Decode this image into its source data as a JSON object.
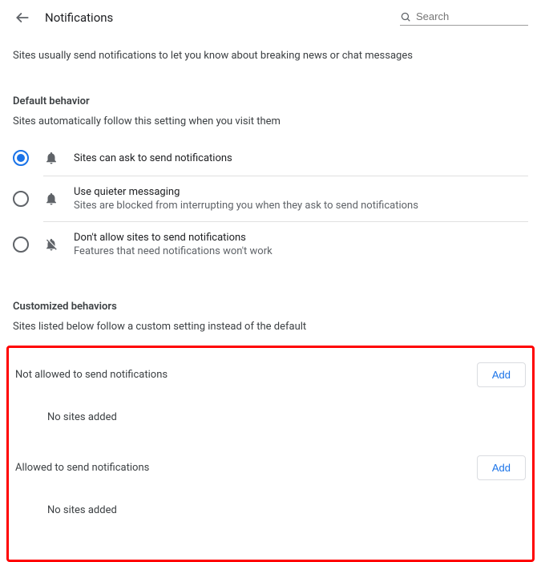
{
  "header": {
    "title": "Notifications",
    "search_placeholder": "Search"
  },
  "intro": "Sites usually send notifications to let you know about breaking news or chat messages",
  "default_behavior": {
    "heading": "Default behavior",
    "sub": "Sites automatically follow this setting when you visit them",
    "options": [
      {
        "title": "Sites can ask to send notifications",
        "desc": "",
        "selected": true
      },
      {
        "title": "Use quieter messaging",
        "desc": "Sites are blocked from interrupting you when they ask to send notifications",
        "selected": false
      },
      {
        "title": "Don't allow sites to send notifications",
        "desc": "Features that need notifications won't work",
        "selected": false
      }
    ]
  },
  "customized": {
    "heading": "Customized behaviors",
    "sub": "Sites listed below follow a custom setting instead of the default",
    "not_allowed": {
      "label": "Not allowed to send notifications",
      "add_label": "Add",
      "empty": "No sites added"
    },
    "allowed": {
      "label": "Allowed to send notifications",
      "add_label": "Add",
      "empty": "No sites added"
    }
  }
}
